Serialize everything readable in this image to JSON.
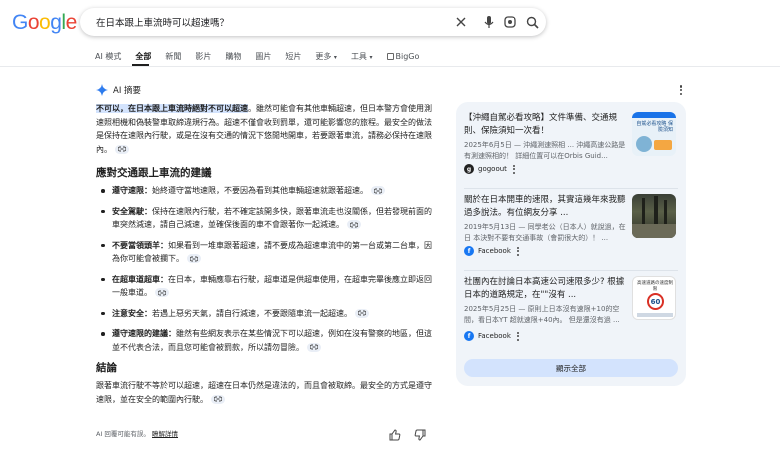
{
  "logo": "Google",
  "search": {
    "query": "在日本跟上車流時可以超速嗎？"
  },
  "tabs": [
    {
      "label": "AI 模式"
    },
    {
      "label": "全部"
    },
    {
      "label": "新聞"
    },
    {
      "label": "影片"
    },
    {
      "label": "購物"
    },
    {
      "label": "圖片"
    },
    {
      "label": "短片"
    },
    {
      "label": "更多"
    },
    {
      "label": "工具"
    },
    {
      "label": "BigGo"
    }
  ],
  "ai": {
    "title": "AI 摘要",
    "intro_highlight": "不可以，在日本跟上車流時絕對不可以超速",
    "intro_rest": "。雖然可能會有其他車輛超速，但日本警方會使用測速照相機和偽裝警車取締違規行為。超速不僅會收到罰單，還可能影響您的旅程。最安全的做法是保持在速限內行駛，或是在沒有交通的情況下悠閒地開車，若要跟著車流，請務必保持在速限內。",
    "section_title": "應對交通跟上車流的建議",
    "items": [
      {
        "term": "遵守速限：",
        "text": "始終遵守當地速限，不要因為看到其他車輛超速就跟著超速。"
      },
      {
        "term": "安全駕駛：",
        "text": "保持在速限內行駛，若不確定該開多快，跟著車流走也沒關係，但若發現前面的車突然減速，請自己減速，並確保後面的車不會跟著你一起減速。"
      },
      {
        "term": "不要當領頭羊：",
        "text": "如果看到一堆車跟著超速，請不要成為超速車流中的第一台或第二台車，因為你可能會被攔下。"
      },
      {
        "term": "在超車道超車：",
        "text": "在日本，車輛應靠右行駛，超車道是供超車使用，在超車完畢後應立即返回一般車道。"
      },
      {
        "term": "注意安全：",
        "text": "若遇上惡劣天氣，請自行減速，不要跟隨車流一起超速。"
      },
      {
        "term": "遵守速限的建議：",
        "text": "雖然有些網友表示在某些情況下可以超速，例如在沒有警察的地區，但這並不代表合法，而且您可能會被罰款，所以請勿冒險。"
      }
    ],
    "conclusion_title": "結論",
    "conclusion": "跟著車流行駛不等於可以超速，超速在日本仍然是違法的，而且會被取締。最安全的方式是遵守速限，並在安全的範圍內行駛。",
    "footer_note": "AI 回覆可能有誤。",
    "footer_link": "瞭解詳情"
  },
  "sources": [
    {
      "title": "【沖繩自駕必看攻略】文件準備、交通規則、保險須知一次看！",
      "snippet": "2025年6月5日 — 沖繩測速照相 ... 沖繩高速公路是有測速照相的！ 詳細位置可以在Orbis Guid...",
      "site": "gogoout",
      "fav_color": "#222222",
      "img_caption": "自駕必看攻略 保險須知"
    },
    {
      "title": "關於在日本開車的速限，其實這幾年來我聽過多說法。有位網友分享 ...",
      "snippet": "2019年5月13日 — 同學老公（日本人）就說過，在日 本決對不要有交通事故（會罰很大的）！ ...",
      "site": "Facebook",
      "fav_color": "#1877f2",
      "img_caption": ""
    },
    {
      "title": "社團內在討論日本高速公司速限多少? 根據日本的道路規定，在\"\"沒有 ...",
      "snippet": "2025年5月25日 — 原則上日本沒有速限+10的空間，看日本YT 超就速限+40內。 但是還沒有過 ...",
      "site": "Facebook",
      "fav_color": "#1877f2",
      "img_caption": "高速道路の速度制限",
      "img_number": "60"
    }
  ],
  "show_all": "顯示全部",
  "colors": {
    "accent": "#1a73e8",
    "highlight": "#d3e3fd",
    "panel_bg": "#f0f4f9"
  }
}
